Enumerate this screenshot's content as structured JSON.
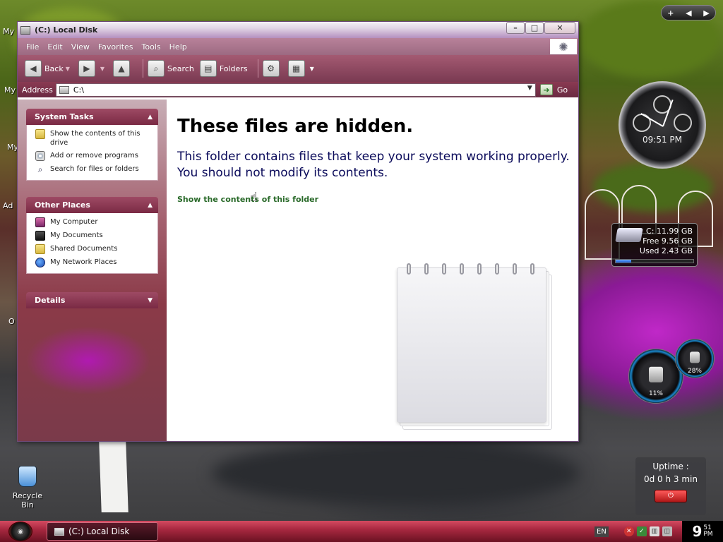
{
  "window": {
    "title": "(C:) Local Disk",
    "controls": {
      "minimize": "–",
      "maximize": "□",
      "close": "✕"
    }
  },
  "menubar": [
    "File",
    "Edit",
    "View",
    "Favorites",
    "Tools",
    "Help"
  ],
  "toolbar": {
    "back_label": "Back",
    "search_label": "Search",
    "folders_label": "Folders"
  },
  "address": {
    "label": "Address",
    "value": "C:\\",
    "go_label": "Go"
  },
  "taskpane": {
    "system_tasks": {
      "title": "System Tasks",
      "items": [
        "Show the contents of this drive",
        "Add or remove programs",
        "Search for files or folders"
      ]
    },
    "other_places": {
      "title": "Other Places",
      "items": [
        "My Computer",
        "My Documents",
        "Shared Documents",
        "My Network Places"
      ]
    },
    "details": {
      "title": "Details"
    }
  },
  "main": {
    "heading": "These files are hidden.",
    "description": "This folder contains files that keep your system working properly. You should not modify its contents.",
    "link": "Show the contents of this folder"
  },
  "desktop": {
    "recycle_bin": "Recycle Bin",
    "partial_labels": [
      "My",
      "My",
      "My",
      "Ad",
      "O"
    ]
  },
  "gadgets": {
    "clock_time": "09:51 PM",
    "drive": {
      "letter_size": "C:  11.99 GB",
      "free": "Free 9.56 GB",
      "used": "Used 2.43 GB",
      "used_fraction": 0.2
    },
    "cpu_percent": "11%",
    "ram_percent": "28%",
    "uptime_label": "Uptime :",
    "uptime_value": "0d 0 h 3 min"
  },
  "taskbar": {
    "task_title": "(C:) Local Disk",
    "language": "EN",
    "clock_hour": "9",
    "clock_min": "51",
    "clock_ampm": "PM"
  },
  "colors": {
    "menubar": "#9c6a82",
    "toolbar": "#7a3a52",
    "link": "#2a6a2a",
    "description": "#0a0a5a",
    "taskbar": "#a82840"
  }
}
